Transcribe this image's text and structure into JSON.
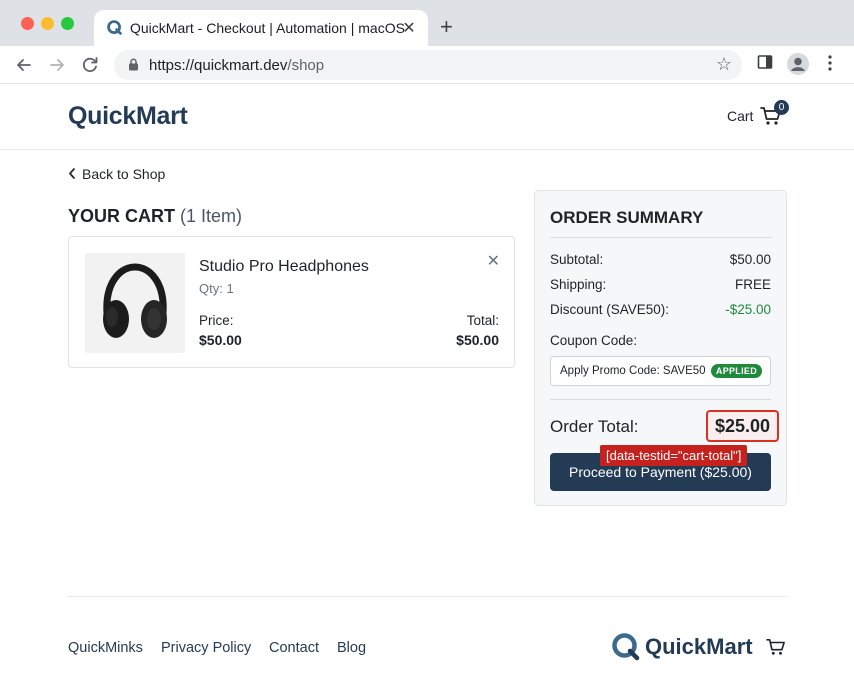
{
  "browser": {
    "tab_title": "QuickMart - Checkout | Automation | macOS",
    "tab_close": "✕",
    "new_tab": "+",
    "url_host": "https://quickmart.dev",
    "url_path": "/shop"
  },
  "header": {
    "logo": "QuickMart",
    "cart_label": "Cart",
    "cart_count": "0"
  },
  "nav": {
    "back_label": "Back to Shop"
  },
  "cart": {
    "heading": "YOUR CART",
    "item_count": "(1 Item)",
    "items": [
      {
        "name": "Studio Pro Headphones",
        "qty": "Qty: 1",
        "price_label": "Price:",
        "price": "$50.00",
        "total_label": "Total:",
        "total": "$50.00"
      }
    ]
  },
  "summary": {
    "title": "ORDER SUMMARY",
    "subtotal_label": "Subtotal:",
    "subtotal": "$50.00",
    "shipping_label": "Shipping:",
    "shipping": "FREE",
    "discount_label": "Discount (SAVE50):",
    "discount": "-$25.00",
    "coupon_label": "Coupon Code:",
    "coupon_text": "Apply Promo Code: SAVE50",
    "coupon_status": "APPLIED",
    "order_total_label": "Order Total:",
    "order_total": "$25.00",
    "pay_button": "Proceed to Payment ($25.00)",
    "testid_tag": "[data-testid=\"cart-total\"]"
  },
  "footer": {
    "links": [
      "QuickMinks",
      "Privacy Policy",
      "Contact",
      "Blog"
    ],
    "logo": "QuickMart"
  },
  "colors": {
    "brand": "#243b55",
    "success": "#1f8a3c",
    "highlight": "#d93025"
  }
}
